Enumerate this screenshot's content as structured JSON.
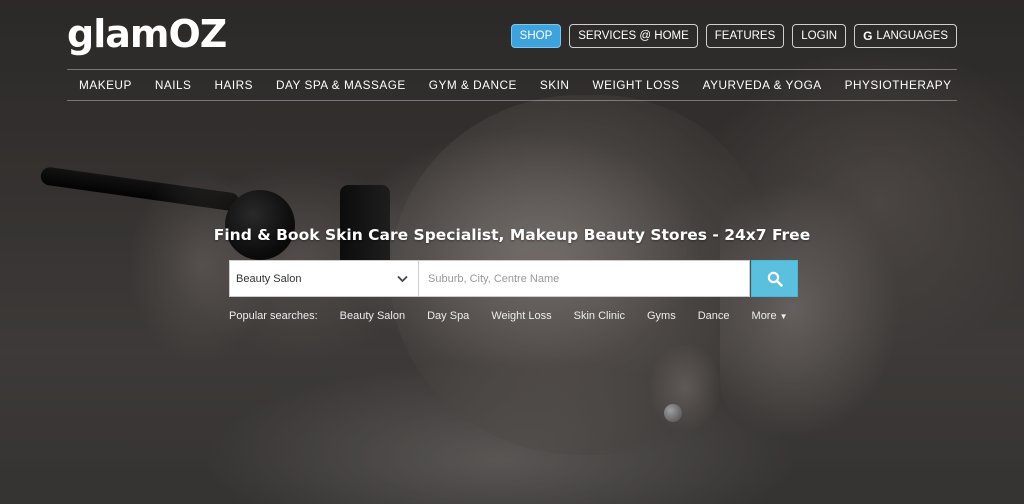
{
  "brand": {
    "logo": "glamOZ"
  },
  "topnav": [
    {
      "label": "SHOP"
    },
    {
      "label": "SERVICES @ HOME"
    },
    {
      "label": "FEATURES"
    },
    {
      "label": "LOGIN"
    },
    {
      "label": "LANGUAGES"
    }
  ],
  "categories": [
    "MAKEUP",
    "NAILS",
    "HAIRS",
    "DAY SPA & MASSAGE",
    "GYM & DANCE",
    "SKIN",
    "WEIGHT LOSS",
    "AYURVEDA & YOGA",
    "PHYSIOTHERAPY"
  ],
  "hero": {
    "headline": "Find & Book Skin Care Specialist, Makeup Beauty Stores - 24x7 Free"
  },
  "search": {
    "category_value": "Beauty Salon",
    "location_placeholder": "Suburb, City, Centre Name"
  },
  "popular": {
    "label": "Popular searches:",
    "items": [
      "Beauty Salon",
      "Day Spa",
      "Weight Loss",
      "Skin Clinic",
      "Gyms",
      "Dance"
    ],
    "more": "More"
  },
  "colors": {
    "primary": "#3ea3dc",
    "search_button": "#5bc0de"
  }
}
